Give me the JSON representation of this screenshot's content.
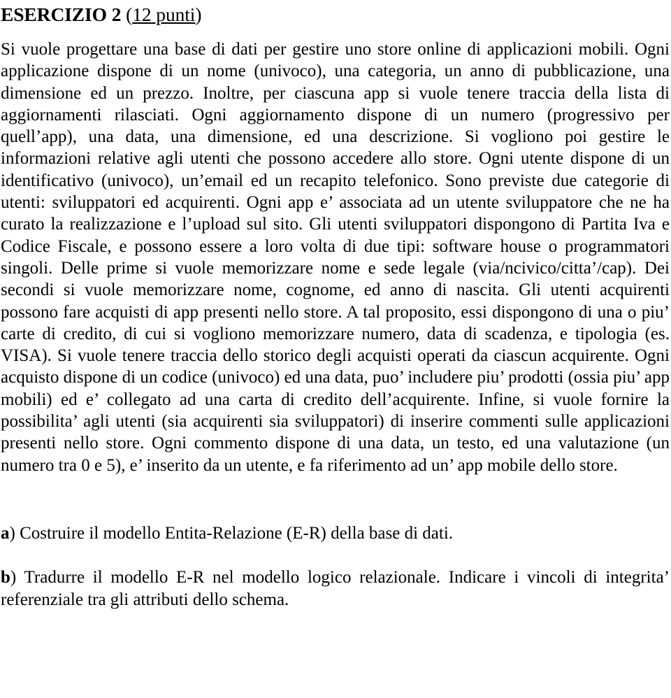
{
  "document": {
    "title": {
      "heading": "ESERCIZIO 2",
      "points_open": "(",
      "points_underlined": "12 punti",
      "points_close": ")"
    },
    "paragraphs": [
      {
        "id": "problem-statement",
        "text": "Si vuole progettare una base di dati per gestire uno store online di applicazioni mobili. Ogni applicazione dispone di un nome (univoco), una categoria, un anno di pubblicazione, una dimensione ed un prezzo. Inoltre, per ciascuna app si vuole tenere traccia della lista di aggiornamenti rilasciati. Ogni aggiornamento dispone di un numero (progressivo per quell’app), una data, una dimensione, ed una descrizione. Si vogliono poi gestire le informazioni relative agli utenti che possono accedere allo store. Ogni utente dispone di un identificativo (univoco), un’email ed un recapito telefonico. Sono previste due categorie di utenti: sviluppatori ed acquirenti. Ogni app e’ associata ad un utente sviluppatore che ne ha curato la realizzazione e l’upload sul sito. Gli utenti sviluppatori dispongono di Partita Iva e Codice Fiscale, e possono essere a loro volta di due tipi: software house o programmatori singoli. Delle prime si vuole memorizzare nome e sede legale (via/ncivico/citta’/cap). Dei secondi si vuole memorizzare nome, cognome, ed anno di nascita. Gli utenti acquirenti possono fare acquisti di app presenti nello store. A tal proposito, essi dispongono di una o piu’ carte di credito, di cui si vogliono memorizzare numero, data di scadenza, e tipologia (es. VISA). Si vuole tenere traccia dello storico degli acquisti operati da ciascun acquirente. Ogni acquisto dispone di un codice (univoco) ed una data, puo’ includere piu’ prodotti (ossia piu’ app mobili) ed e’ collegato ad una carta di credito dell’acquirente. Infine, si vuole fornire la possibilita’ agli utenti (sia acquirenti sia sviluppatori) di inserire commenti sulle applicazioni presenti nello store. Ogni commento dispone di  una data, un testo, ed una valutazione (un numero tra 0 e 5), e’ inserito da un utente, e fa riferimento ad un’ app mobile dello store."
      }
    ],
    "questions": [
      {
        "id": "question-a",
        "marker": "a",
        "marker_suffix": ")",
        "text": " Costruire il modello Entita-Relazione (E-R) della base di dati."
      },
      {
        "id": "question-b",
        "marker": "b",
        "marker_suffix": ")",
        "text": " Tradurre il modello E-R nel modello logico relazionale. Indicare i vincoli di integrita’ referenziale tra gli attributi dello schema."
      }
    ]
  }
}
